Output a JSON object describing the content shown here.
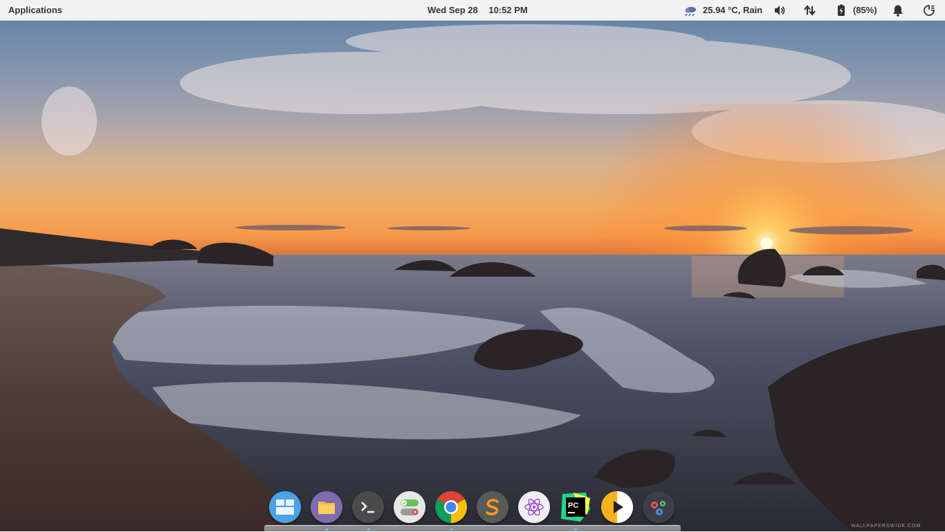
{
  "top_panel": {
    "applications_label": "Applications",
    "date": "Wed Sep 28",
    "time": "10:52 PM",
    "weather": "25.94 °C, Rain",
    "battery_percent": "(85%)"
  },
  "indicators": [
    "weather-rain-icon",
    "volume-icon",
    "network-arrows-icon",
    "battery-charging-icon",
    "notification-bell-icon",
    "power-session-icon"
  ],
  "dock": {
    "apps": [
      {
        "name": "multitasking-view",
        "color": "#4aa3e6"
      },
      {
        "name": "files",
        "color": "#7e6bb0"
      },
      {
        "name": "terminal",
        "color": "#4a4a4a"
      },
      {
        "name": "system-settings-toggles",
        "color": "#e8e8e8"
      },
      {
        "name": "google-chrome",
        "color": "#db4437"
      },
      {
        "name": "sublime-text",
        "color": "#5a5a5a"
      },
      {
        "name": "atom",
        "color": "#f0eef5"
      },
      {
        "name": "pycharm",
        "color": "#21d789"
      },
      {
        "name": "media-player",
        "color": "#f8b31c"
      },
      {
        "name": "gears-settings",
        "color": "#3a3f4a"
      }
    ]
  },
  "watermark": "WALLPAPERSWIDE.COM"
}
